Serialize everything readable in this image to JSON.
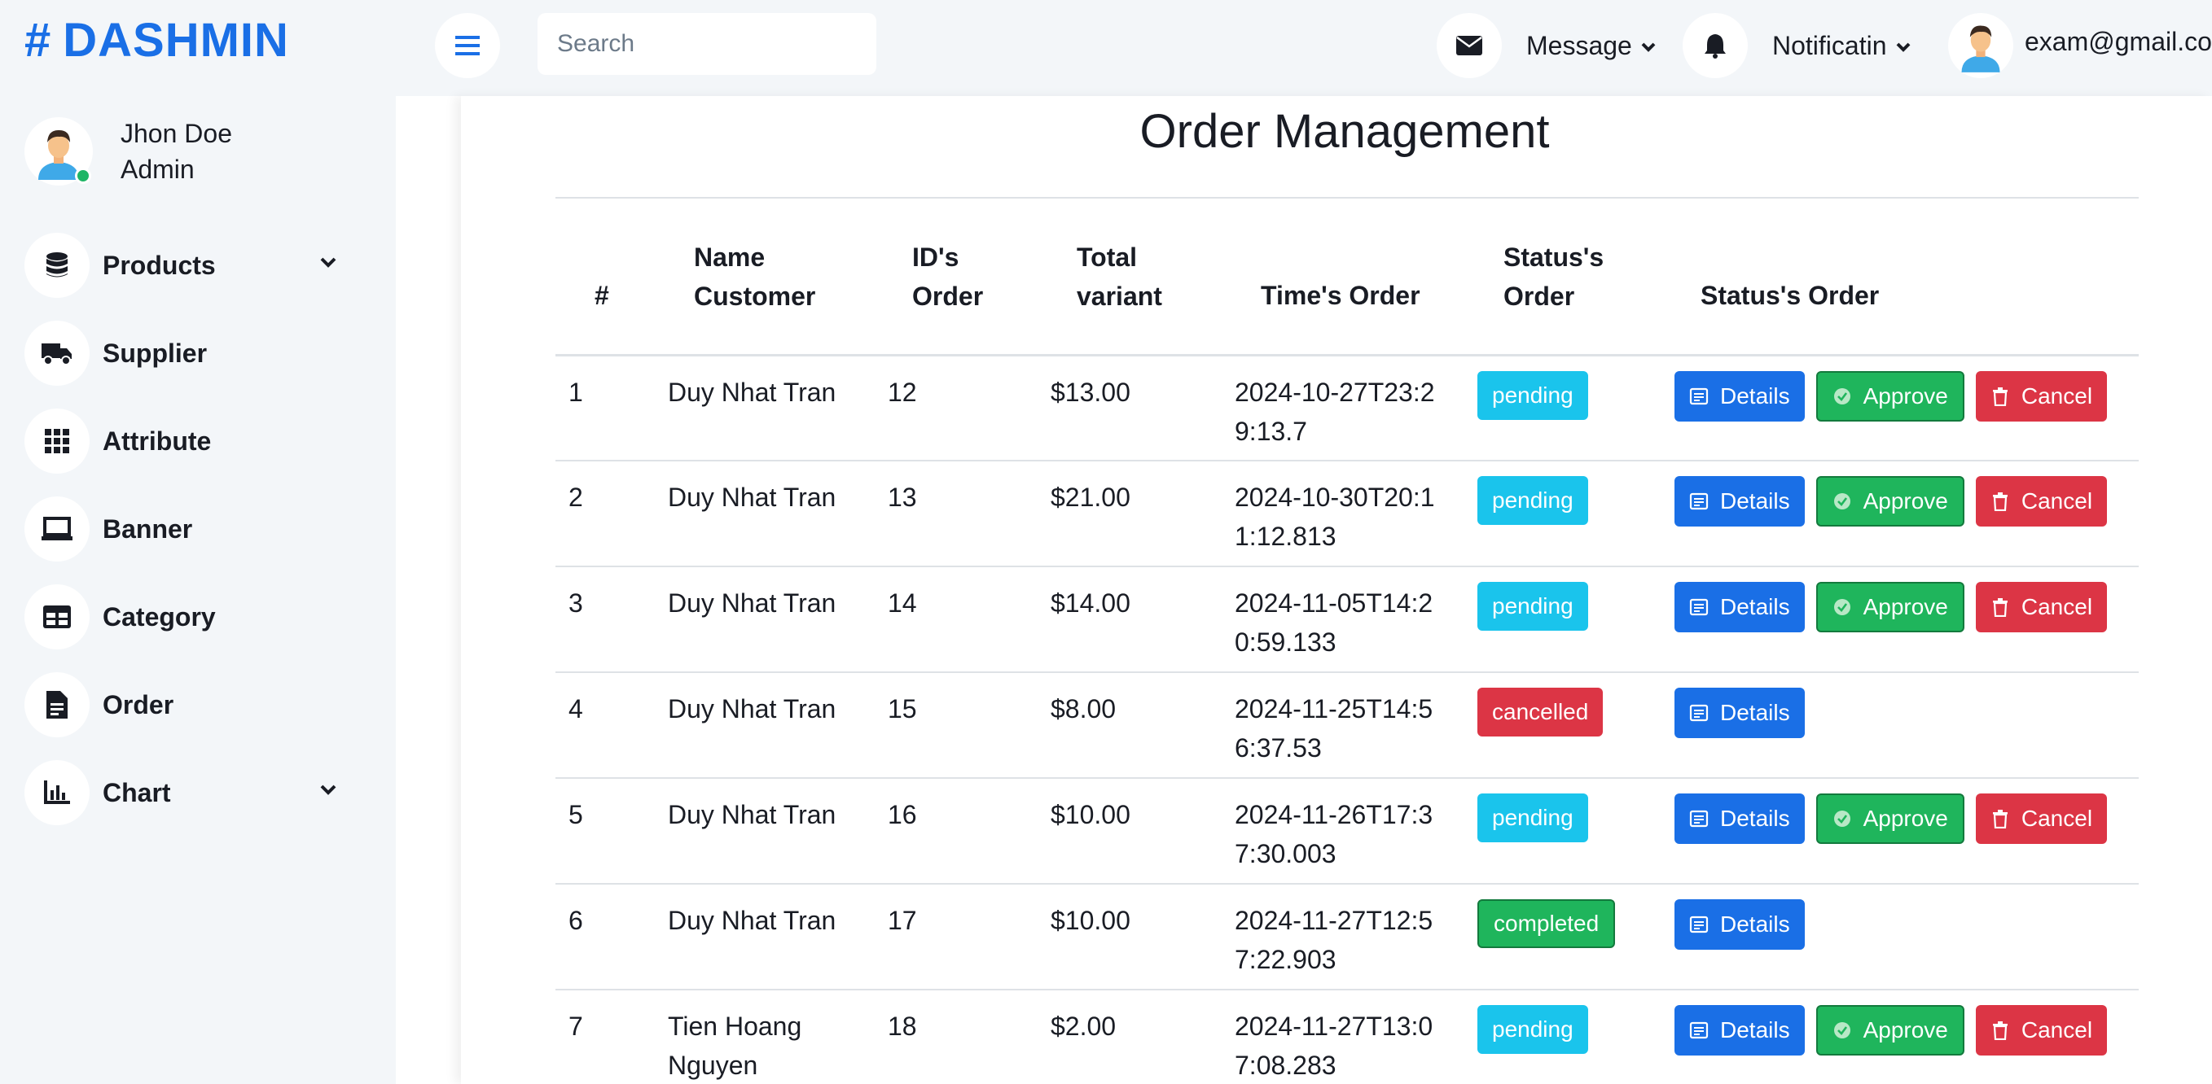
{
  "brand": {
    "hash": "#",
    "name": "DASHMIN"
  },
  "user": {
    "name": "Jhon Doe",
    "role": "Admin"
  },
  "nav": {
    "products": "Products",
    "supplier": "Supplier",
    "attribute": "Attribute",
    "banner": "Banner",
    "category": "Category",
    "order": "Order",
    "chart": "Chart"
  },
  "topbar": {
    "search_placeholder": "Search",
    "message": "Message",
    "notification": "Notificatin",
    "email": "exam@gmail.com"
  },
  "page": {
    "title": "Order Management"
  },
  "table": {
    "headers": {
      "index": "#",
      "name": "Name Customer",
      "id": "ID's Order",
      "total": "Total variant",
      "time": "Time's Order",
      "status": "Status's Order",
      "actions": "Status's Order"
    },
    "buttons": {
      "details": "Details",
      "approve": "Approve",
      "cancel": "Cancel"
    },
    "rows": [
      {
        "index": "1",
        "name": "Duy Nhat Tran",
        "id": "12",
        "total": "$13.00",
        "time": "2024-10-27T23:29:13.7",
        "status": "pending"
      },
      {
        "index": "2",
        "name": "Duy Nhat Tran",
        "id": "13",
        "total": "$21.00",
        "time": "2024-10-30T20:11:12.813",
        "status": "pending"
      },
      {
        "index": "3",
        "name": "Duy Nhat Tran",
        "id": "14",
        "total": "$14.00",
        "time": "2024-11-05T14:20:59.133",
        "status": "pending"
      },
      {
        "index": "4",
        "name": "Duy Nhat Tran",
        "id": "15",
        "total": "$8.00",
        "time": "2024-11-25T14:56:37.53",
        "status": "cancelled"
      },
      {
        "index": "5",
        "name": "Duy Nhat Tran",
        "id": "16",
        "total": "$10.00",
        "time": "2024-11-26T17:37:30.003",
        "status": "pending"
      },
      {
        "index": "6",
        "name": "Duy Nhat Tran",
        "id": "17",
        "total": "$10.00",
        "time": "2024-11-27T12:57:22.903",
        "status": "completed"
      },
      {
        "index": "7",
        "name": "Tien Hoang Nguyen",
        "id": "18",
        "total": "$2.00",
        "time": "2024-11-27T13:07:08.283",
        "status": "pending"
      }
    ]
  },
  "colors": {
    "primary": "#1a6fe6",
    "pending": "#1ac4ec",
    "cancelled": "#dc3545",
    "completed": "#1fb55c",
    "approve": "#1fb55c",
    "cancel": "#dc3545"
  }
}
